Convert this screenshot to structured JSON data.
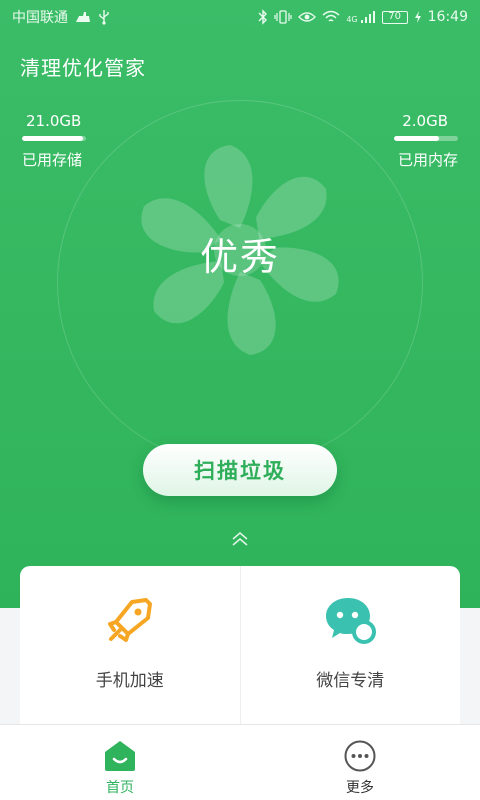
{
  "status_bar": {
    "carrier": "中国联通",
    "network": "4G",
    "battery": "70",
    "time": "16:49"
  },
  "header": {
    "title": "清理优化管家"
  },
  "storage": {
    "value": "21.0GB",
    "label": "已用存储",
    "usage_fraction": 0.95
  },
  "memory": {
    "value": "2.0GB",
    "label": "已用内存",
    "usage_fraction": 0.7
  },
  "status": {
    "text": "优秀"
  },
  "scan_button": {
    "label": "扫描垃圾"
  },
  "features": [
    {
      "label": "手机加速",
      "icon": "rocket-icon",
      "color": "#f6a623"
    },
    {
      "label": "微信专清",
      "icon": "wechat-icon",
      "color": "#3bc1b0"
    }
  ],
  "tabs": [
    {
      "label": "首页",
      "icon": "home-icon",
      "active": true
    },
    {
      "label": "更多",
      "icon": "more-icon",
      "active": false
    }
  ],
  "colors": {
    "primary": "#35b760",
    "accent_orange": "#f6a623",
    "accent_teal": "#3bc1b0"
  }
}
